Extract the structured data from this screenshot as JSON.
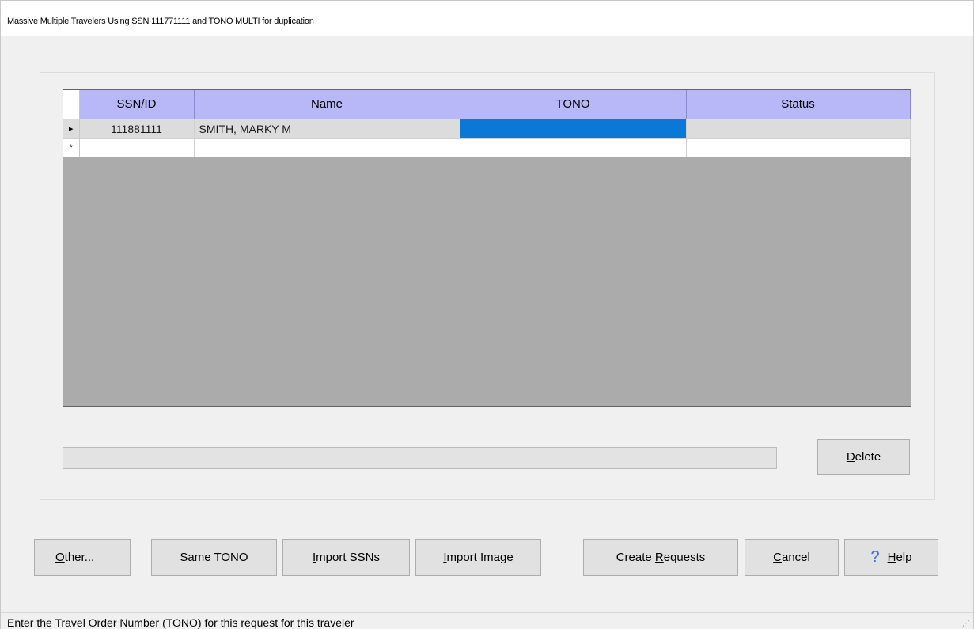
{
  "window": {
    "title": "Massive Multiple Travelers Using SSN 111771111 and TONO MULTI for duplication"
  },
  "grid": {
    "columns": [
      "SSN/ID",
      "Name",
      "TONO",
      "Status"
    ],
    "rows": [
      {
        "ssn": "111881111",
        "name": "SMITH, MARKY M",
        "tono": "",
        "status": ""
      }
    ],
    "current_row_marker": "▸",
    "new_row_marker": "*",
    "selection_color": "#0a78d7",
    "header_color": "#b8b8f8"
  },
  "buttons": {
    "delete": {
      "pre": "",
      "accel": "D",
      "post": "elete"
    },
    "other": {
      "pre": "",
      "accel": "O",
      "post": "ther..."
    },
    "same_tono": {
      "pre": "Same TONO",
      "accel": "",
      "post": ""
    },
    "import_ssns": {
      "pre": "",
      "accel": "I",
      "post": "mport SSNs"
    },
    "import_image": {
      "pre": "",
      "accel": "I",
      "post": "mport Image"
    },
    "create_requests": {
      "pre": "Create ",
      "accel": "R",
      "post": "equests"
    },
    "cancel": {
      "pre": "",
      "accel": "C",
      "post": "ancel"
    },
    "help": {
      "pre": "",
      "accel": "H",
      "post": "elp",
      "icon": "help-question-icon",
      "glyph": "?"
    }
  },
  "status": {
    "text": "Enter the Travel Order Number (TONO) for this request for this traveler"
  }
}
